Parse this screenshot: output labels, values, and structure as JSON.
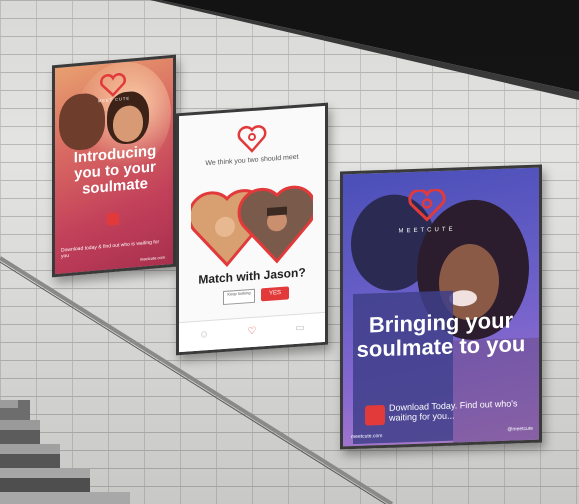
{
  "scene": {
    "description_colors": {
      "wall": "#e4e4e2",
      "brand_red": "#e23a3a",
      "poster3_blue": "#4b4fb8"
    }
  },
  "poster_left": {
    "brand": "MEET CUTE",
    "headline": "Introducing you to your soulmate",
    "small_text": "Download today & find out who is waiting for you",
    "footer": "meetcute.com"
  },
  "poster_center": {
    "tagline": "We think you two should meet",
    "match_text": "Match with Jason?",
    "maybe_label": "Keep looking",
    "yes_label": "YES",
    "icons": [
      "user-icon",
      "heart-icon",
      "chat-icon"
    ]
  },
  "poster_right": {
    "brand": "MEETCUTE",
    "headline": "Bringing your soulmate to you",
    "download_text": "Download Today. Find out who's waiting for you...",
    "url": "meetcute.com",
    "social": "@meetcute"
  }
}
